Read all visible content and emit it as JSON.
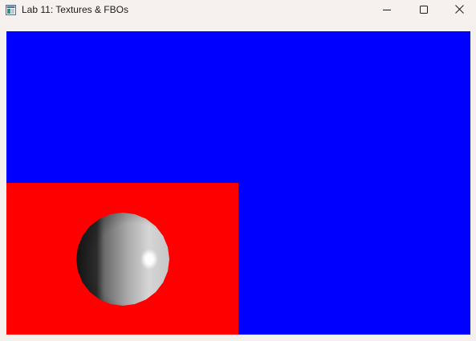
{
  "window": {
    "title": "Lab 11: Textures & FBOs",
    "icon": "app-window-icon",
    "controls": {
      "minimize_icon": "minimize-icon",
      "maximize_icon": "maximize-icon",
      "close_icon": "close-icon"
    }
  },
  "scene": {
    "background_color": "#0000ff",
    "quad_color": "#ff0000",
    "sphere_colors": {
      "highlight": "#ffffff",
      "light": "#c8c8c8",
      "mid": "#8a8a8a",
      "shadow": "#1e1e1e"
    }
  }
}
